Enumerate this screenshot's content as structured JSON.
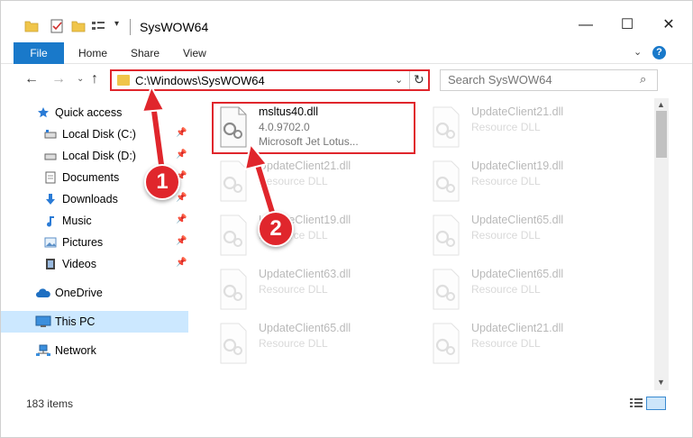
{
  "window": {
    "title": "SysWOW64",
    "controls": {
      "minimize": "—",
      "maximize": "☐",
      "close": "✕"
    }
  },
  "quick_access_toolbar": {
    "dropdown": "▾"
  },
  "ribbon": {
    "tabs": [
      {
        "label": "File",
        "active": true
      },
      {
        "label": "Home"
      },
      {
        "label": "Share"
      },
      {
        "label": "View"
      }
    ],
    "expand_icon": "⌄",
    "help_label": "?"
  },
  "navigation": {
    "back": "←",
    "forward": "→",
    "recent": "⌄",
    "up": "↑",
    "address": "C:\\Windows\\SysWOW64",
    "address_dropdown": "⌄",
    "refresh": "↻",
    "search_placeholder": "Search SysWOW64",
    "search_icon": "⌕"
  },
  "sidebar": {
    "items": [
      {
        "label": "Quick access",
        "icon": "star-icon",
        "pinned": false,
        "selected": false
      },
      {
        "label": "Local Disk (C:)",
        "icon": "drive-icon",
        "pinned": true,
        "selected": false
      },
      {
        "label": "Local Disk (D:)",
        "icon": "drive-icon",
        "pinned": true,
        "selected": false
      },
      {
        "label": "Documents",
        "icon": "documents-icon",
        "pinned": true,
        "selected": false
      },
      {
        "label": "Downloads",
        "icon": "downloads-icon",
        "pinned": true,
        "selected": false
      },
      {
        "label": "Music",
        "icon": "music-icon",
        "pinned": true,
        "selected": false
      },
      {
        "label": "Pictures",
        "icon": "pictures-icon",
        "pinned": true,
        "selected": false
      },
      {
        "label": "Videos",
        "icon": "videos-icon",
        "pinned": true,
        "selected": false
      },
      {
        "label": "OneDrive",
        "icon": "cloud-icon",
        "pinned": false,
        "selected": false
      },
      {
        "label": "This PC",
        "icon": "computer-icon",
        "pinned": false,
        "selected": true
      },
      {
        "label": "Network",
        "icon": "network-icon",
        "pinned": false,
        "selected": false
      }
    ],
    "pin_glyph": "📌"
  },
  "files": [
    {
      "name": "msltus40.dll",
      "line1": "4.0.9702.0",
      "line2": "Microsoft Jet Lotus...",
      "selected": true
    },
    {
      "name": "UpdateClient21.dll",
      "line1": "Resource DLL",
      "line2": ""
    },
    {
      "name": "UpdateClient21.dll",
      "line1": "Resource DLL",
      "line2": ""
    },
    {
      "name": "UpdateClient19.dll",
      "line1": "Resource DLL",
      "line2": ""
    },
    {
      "name": "UpdateClient19.dll",
      "line1": "Resource DLL",
      "line2": ""
    },
    {
      "name": "UpdateClient65.dll",
      "line1": "Resource DLL",
      "line2": ""
    },
    {
      "name": "UpdateClient63.dll",
      "line1": "Resource DLL",
      "line2": ""
    },
    {
      "name": "UpdateClient65.dll",
      "line1": "Resource DLL",
      "line2": ""
    },
    {
      "name": "UpdateClient65.dll",
      "line1": "Resource DLL",
      "line2": ""
    },
    {
      "name": "UpdateClient21.dll",
      "line1": "Resource DLL",
      "line2": ""
    }
  ],
  "status": {
    "item_count": "183 items"
  },
  "scrollbar": {
    "up": "▲",
    "down": "▼"
  },
  "annotations": {
    "badge1": "1",
    "badge2": "2"
  },
  "colors": {
    "accent": "#1979ca",
    "highlight": "#e0262c",
    "selected_bg": "#cce8ff"
  }
}
